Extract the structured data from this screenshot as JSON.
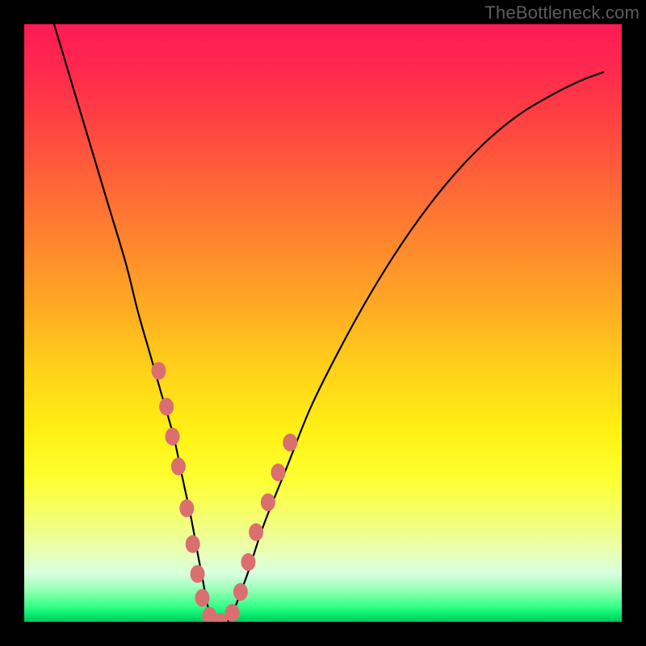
{
  "watermark": "TheBottleneck.com",
  "chart_data": {
    "type": "line",
    "title": "",
    "xlabel": "",
    "ylabel": "",
    "ylim": [
      0,
      100
    ],
    "xlim": [
      0,
      100
    ],
    "series": [
      {
        "name": "curve",
        "x": [
          5,
          8,
          11,
          14,
          17,
          19,
          21,
          23,
          25,
          26.5,
          28,
          29.5,
          31.5,
          34,
          37,
          40,
          44,
          48,
          53,
          58,
          63,
          68,
          73,
          78,
          83,
          88,
          93,
          97
        ],
        "y": [
          100,
          90,
          80,
          70,
          60,
          52,
          45,
          38,
          31,
          24,
          17,
          9,
          0,
          0,
          7,
          16,
          26,
          36,
          46,
          55,
          63,
          70,
          76,
          81,
          85,
          88,
          90.5,
          92
        ]
      }
    ],
    "markers": [
      {
        "x": 22.5,
        "y": 42
      },
      {
        "x": 23.8,
        "y": 36
      },
      {
        "x": 24.8,
        "y": 31
      },
      {
        "x": 25.8,
        "y": 26
      },
      {
        "x": 27.2,
        "y": 19
      },
      {
        "x": 28.2,
        "y": 13
      },
      {
        "x": 29.0,
        "y": 8
      },
      {
        "x": 29.8,
        "y": 4
      },
      {
        "x": 31.0,
        "y": 1
      },
      {
        "x": 32.8,
        "y": 0
      },
      {
        "x": 34.8,
        "y": 1.5
      },
      {
        "x": 36.2,
        "y": 5
      },
      {
        "x": 37.5,
        "y": 10
      },
      {
        "x": 38.8,
        "y": 15
      },
      {
        "x": 40.8,
        "y": 20
      },
      {
        "x": 42.5,
        "y": 25
      },
      {
        "x": 44.5,
        "y": 30
      }
    ],
    "gradient_stops": [
      {
        "pct": 0,
        "color": "#ff1b55"
      },
      {
        "pct": 18,
        "color": "#ff4840"
      },
      {
        "pct": 38,
        "color": "#ff8b2c"
      },
      {
        "pct": 58,
        "color": "#ffd21a"
      },
      {
        "pct": 76,
        "color": "#feff30"
      },
      {
        "pct": 92,
        "color": "#d8ffe0"
      },
      {
        "pct": 100,
        "color": "#00c558"
      }
    ],
    "marker_color": "#db6f6f",
    "curve_color": "#000000"
  }
}
